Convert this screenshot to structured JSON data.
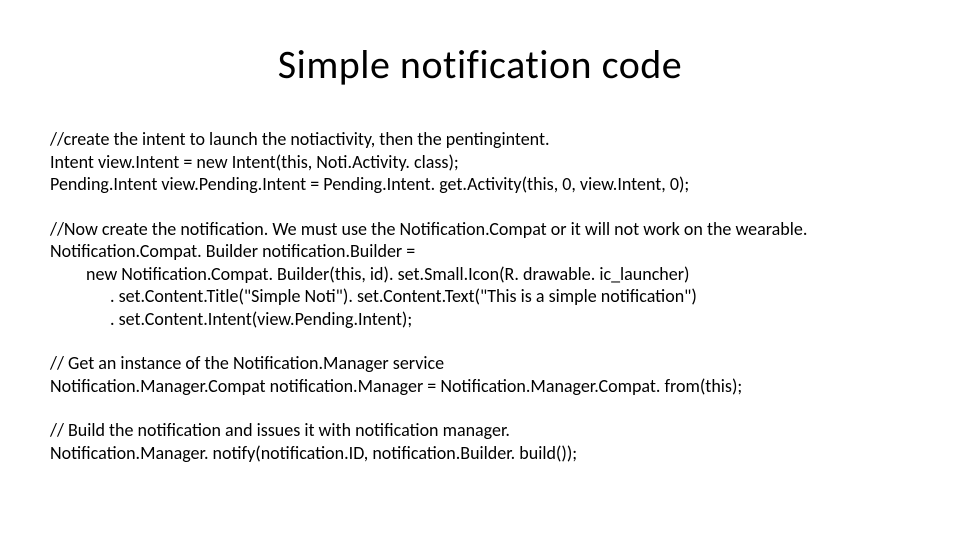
{
  "title": "Simple notification code",
  "lines": {
    "l1": "//create the intent to launch the notiactivity, then the pentingintent.",
    "l2": "Intent view.Intent = new Intent(this, Noti.Activity. class);",
    "l3": "Pending.Intent view.Pending.Intent = Pending.Intent. get.Activity(this, 0, view.Intent, 0);",
    "l4": "//Now create the notification.  We must use the Notification.Compat or it will not work on the wearable.",
    "l5": "Notification.Compat. Builder notification.Builder =",
    "l6": "new Notification.Compat. Builder(this, id). set.Small.Icon(R. drawable. ic_launcher)",
    "l7": ". set.Content.Title(\"Simple Noti\"). set.Content.Text(\"This is a simple notification\")",
    "l8": ". set.Content.Intent(view.Pending.Intent);",
    "l9": "// Get an instance of the Notification.Manager service",
    "l10": "Notification.Manager.Compat notification.Manager = Notification.Manager.Compat. from(this);",
    "l11": "// Build the notification and issues it with notification manager.",
    "l12": "Notification.Manager. notify(notification.ID, notification.Builder. build());"
  }
}
